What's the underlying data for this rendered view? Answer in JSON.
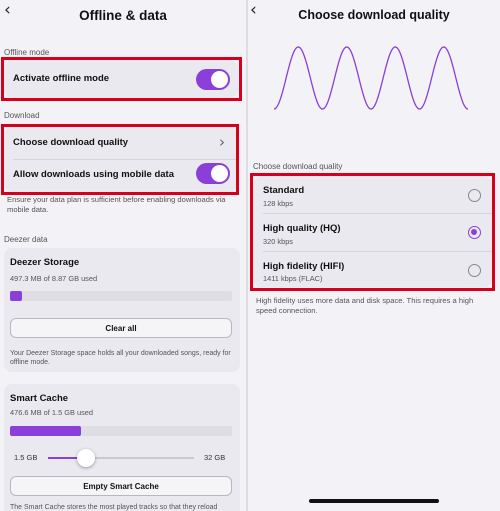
{
  "colors": {
    "accent": "#8b3fd9",
    "highlight": "#d6001c"
  },
  "left": {
    "back_icon": "chevron-left-icon",
    "title": "Offline & data",
    "offline_mode": {
      "section_label": "Offline mode",
      "label": "Activate offline mode",
      "enabled": true
    },
    "download": {
      "section_label": "Download",
      "choose_quality_label": "Choose download quality",
      "mobile_data_label": "Allow downloads using mobile data",
      "mobile_data_enabled": true,
      "help_text": "Ensure your data plan is sufficient before enabling downloads via mobile data."
    },
    "deezer_data": {
      "section_label": "Deezer data",
      "storage": {
        "title": "Deezer Storage",
        "usage": "497.3 MB of 8.87 GB used",
        "used_fraction": 0.056,
        "clear_button": "Clear all",
        "help_text": "Your Deezer Storage space holds all your downloaded songs, ready for offline mode."
      },
      "smart_cache": {
        "title": "Smart Cache",
        "usage": "476.6 MB of 1.5 GB used",
        "used_fraction": 0.318,
        "slider_min_label": "1.5 GB",
        "slider_max_label": "32 GB",
        "slider_fraction": 0.26,
        "empty_button": "Empty Smart Cache",
        "help_text": "The Smart Cache stores the most played tracks so that they reload"
      }
    }
  },
  "right": {
    "back_icon": "chevron-left-icon",
    "title": "Choose download quality",
    "wave_icon": "sine-wave-illustration",
    "section_label": "Choose download quality",
    "options": [
      {
        "name": "Standard",
        "bitrate": "128 kbps",
        "selected": false
      },
      {
        "name": "High quality (HQ)",
        "bitrate": "320 kbps",
        "selected": true
      },
      {
        "name": "High fidelity (HIFI)",
        "bitrate": "1411 kbps (FLAC)",
        "selected": false
      }
    ],
    "help_text": "High fidelity uses more data and disk space. This requires a high speed connection."
  }
}
